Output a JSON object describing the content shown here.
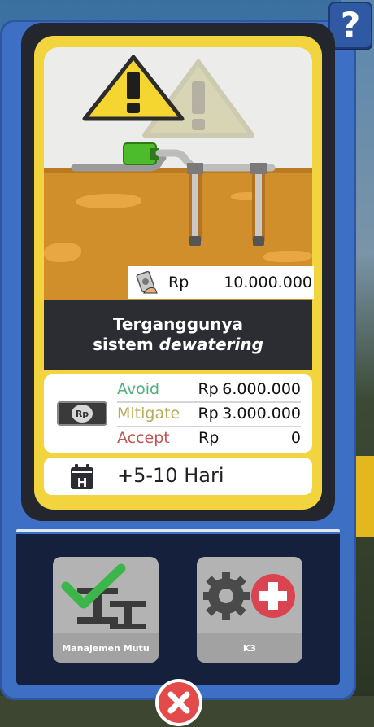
{
  "help": {
    "label": "?"
  },
  "card": {
    "cost": {
      "currency": "Rp",
      "value": "10.000.000"
    },
    "title_line1": "Terganggunya",
    "title_line2_prefix": "sistem ",
    "title_line2_emphasis": "dewatering",
    "options": [
      {
        "name": "Avoid",
        "currency": "Rp",
        "amount": "6.000.000",
        "color": "#4caf7d"
      },
      {
        "name": "Mitigate",
        "currency": "Rp",
        "amount": "3.000.000",
        "color": "#b5ad5a"
      },
      {
        "name": "Accept",
        "currency": "Rp",
        "amount": "0",
        "color": "#c05656"
      }
    ],
    "rp_badge": "Rp",
    "duration": {
      "icon_letter": "H",
      "plus": "+",
      "text": "5-10 Hari"
    }
  },
  "tools": [
    {
      "label": "Manajemen Mutu",
      "icon": "quality-check-beams-icon"
    },
    {
      "label": "K3",
      "icon": "gear-first-aid-icon"
    }
  ],
  "colors": {
    "frame": "#3d6fc5",
    "card_yellow": "#f2d43e",
    "soil": "#d18f2c",
    "panel": "#15203c",
    "close": "#e34a4a"
  }
}
